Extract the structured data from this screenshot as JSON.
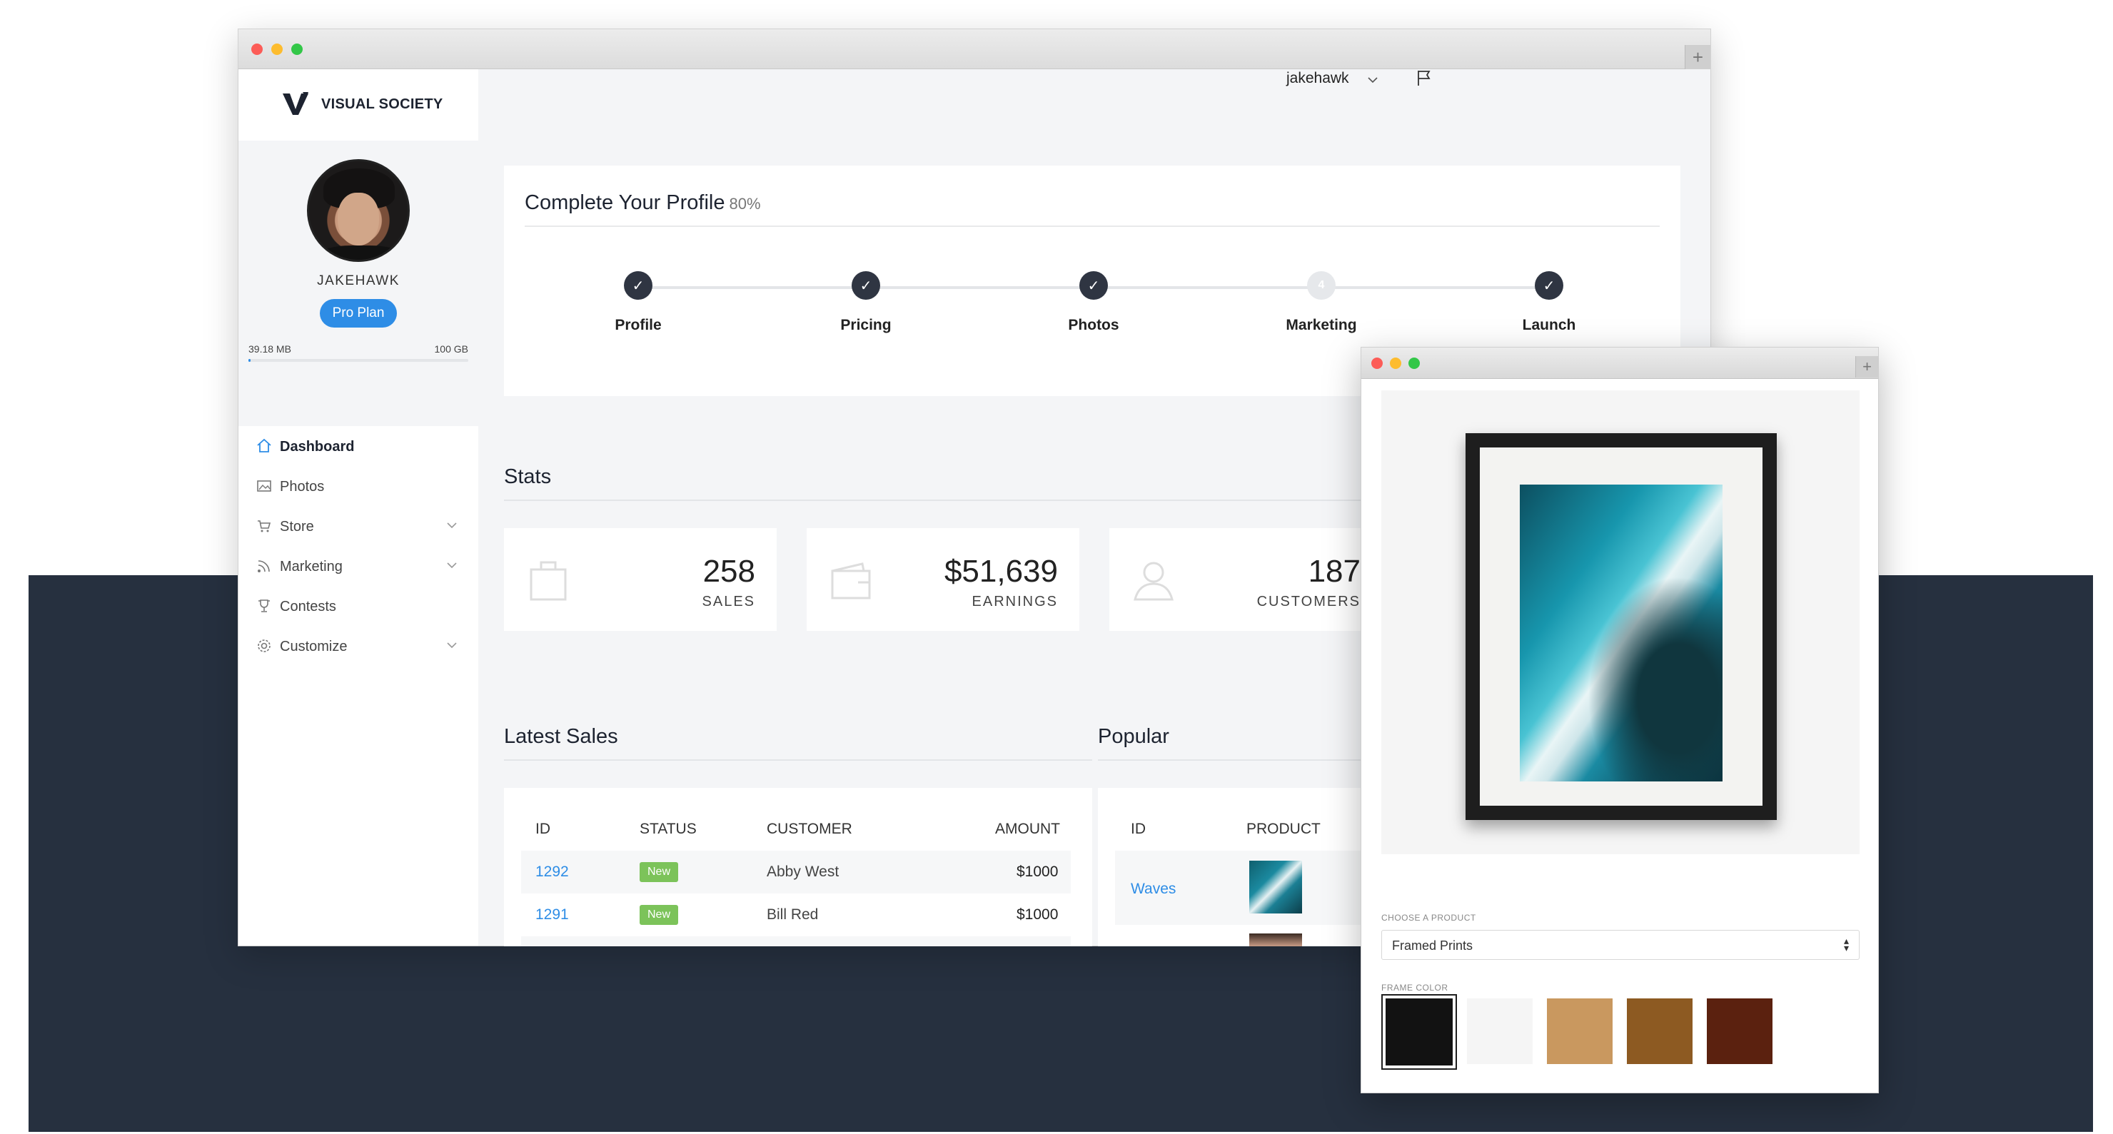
{
  "brand": {
    "name": "VISUAL SOCIETY"
  },
  "profile": {
    "username": "JAKEHAWK",
    "plan": "Pro Plan",
    "storage_used": "39.18 MB",
    "storage_total": "100 GB",
    "storage_fraction": 0.004
  },
  "nav": {
    "items": [
      {
        "label": "Dashboard",
        "icon": "home-icon",
        "active": true,
        "expandable": false
      },
      {
        "label": "Photos",
        "icon": "image-icon",
        "active": false,
        "expandable": false
      },
      {
        "label": "Store",
        "icon": "cart-icon",
        "active": false,
        "expandable": true
      },
      {
        "label": "Marketing",
        "icon": "rss-icon",
        "active": false,
        "expandable": true
      },
      {
        "label": "Contests",
        "icon": "trophy-icon",
        "active": false,
        "expandable": false
      },
      {
        "label": "Customize",
        "icon": "gear-icon",
        "active": false,
        "expandable": true
      }
    ]
  },
  "header": {
    "user": "jakehawk"
  },
  "complete_profile": {
    "title": "Complete Your Profile",
    "percent": "80%",
    "steps": [
      {
        "label": "Profile",
        "done": true,
        "marker": ""
      },
      {
        "label": "Pricing",
        "done": true,
        "marker": ""
      },
      {
        "label": "Photos",
        "done": true,
        "marker": ""
      },
      {
        "label": "Marketing",
        "done": false,
        "marker": "4"
      },
      {
        "label": "Launch",
        "done": true,
        "marker": ""
      }
    ]
  },
  "stats": {
    "title": "Stats",
    "cards": [
      {
        "value": "258",
        "label": "SALES",
        "icon": "shopping-bag-icon"
      },
      {
        "value": "$51,639",
        "label": "EARNINGS",
        "icon": "wallet-icon"
      },
      {
        "value": "187",
        "label": "CUSTOMERS",
        "icon": "user-icon"
      }
    ]
  },
  "latest_sales": {
    "title": "Latest Sales",
    "columns": [
      "ID",
      "STATUS",
      "CUSTOMER",
      "AMOUNT"
    ],
    "rows": [
      {
        "id": "1292",
        "status": "New",
        "customer": "Abby West",
        "amount": "$1000"
      },
      {
        "id": "1291",
        "status": "New",
        "customer": "Bill Red",
        "amount": "$1000"
      }
    ]
  },
  "popular": {
    "title": "Popular",
    "columns": [
      "ID",
      "PRODUCT"
    ],
    "rows": [
      {
        "id": "Waves"
      }
    ]
  },
  "product": {
    "choose_label": "CHOOSE A PRODUCT",
    "selected_product": "Framed Prints",
    "frame_color_label": "FRAME COLOR",
    "swatches": [
      {
        "color": "#121212",
        "selected": true
      },
      {
        "color": "#f5f5f5",
        "selected": false
      },
      {
        "color": "#c9985f",
        "selected": false
      },
      {
        "color": "#8d5a22",
        "selected": false
      },
      {
        "color": "#5b210f",
        "selected": false
      }
    ]
  },
  "colors": {
    "accent": "#2e8de6",
    "navy": "#26303f",
    "badge_new": "#7cc35a",
    "step_done": "#2f3542"
  }
}
